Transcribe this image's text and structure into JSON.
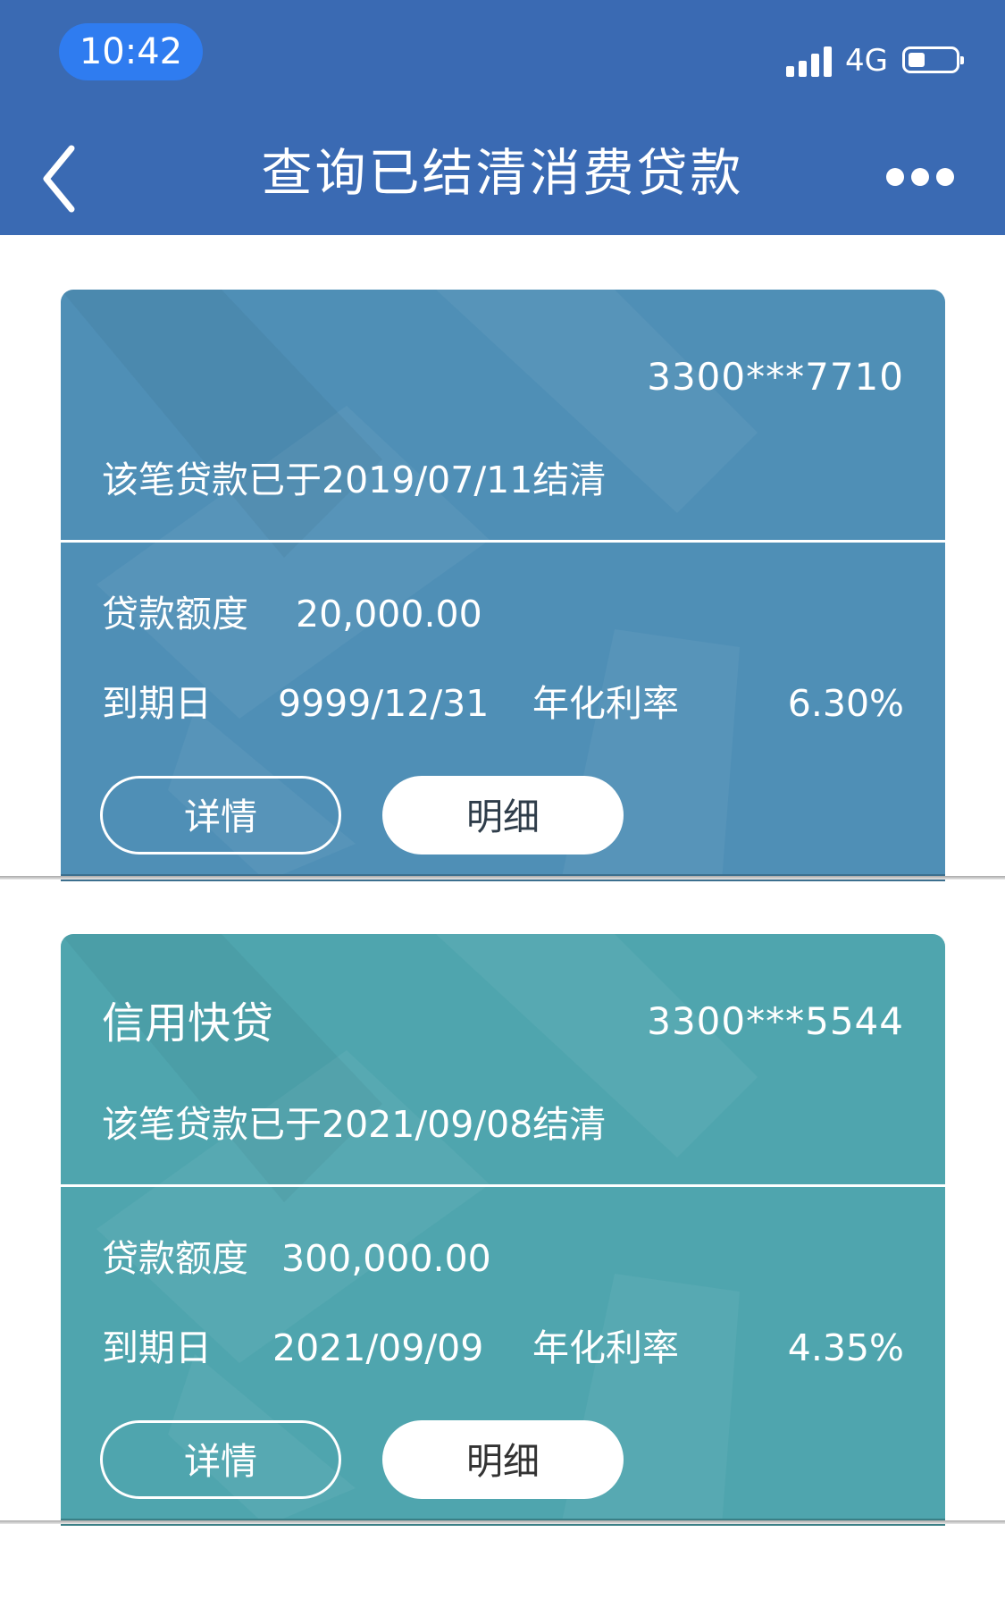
{
  "status_bar": {
    "time": "10:42",
    "network": "4G",
    "icons": [
      "signal-icon",
      "battery-icon"
    ]
  },
  "nav": {
    "title": "查询已结清消费贷款",
    "back_icon": "chevron-left-icon",
    "more_icon": "more-dots-icon"
  },
  "colors": {
    "header": "#3a6ab3",
    "card_1": "#4f8fb6",
    "card_2": "#4fa5ae"
  },
  "loans": [
    {
      "name": "",
      "account": "3300***7710",
      "status": "该笔贷款已于2019/07/11结清",
      "amount_label": "贷款额度",
      "amount": "20,000.00",
      "due_label": "到期日",
      "due_date": "9999/12/31",
      "rate_label": "年化利率",
      "rate": "6.30%",
      "detail_button": "详情",
      "statement_button": "明细"
    },
    {
      "name": "信用快贷",
      "account": "3300***5544",
      "status": "该笔贷款已于2021/09/08结清",
      "amount_label": "贷款额度",
      "amount": "300,000.00",
      "due_label": "到期日",
      "due_date": "2021/09/09",
      "rate_label": "年化利率",
      "rate": "4.35%",
      "detail_button": "详情",
      "statement_button": "明细"
    }
  ]
}
